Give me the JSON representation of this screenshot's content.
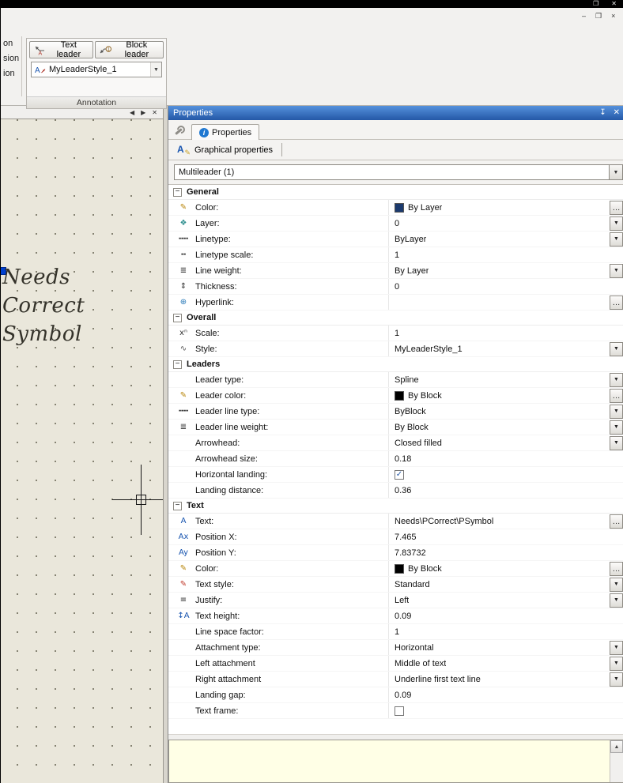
{
  "window": {
    "title_controls": [
      "❐",
      "✕"
    ],
    "doc_controls": [
      "–",
      "❐",
      "×"
    ]
  },
  "ribbon": {
    "left_fragments": [
      "on",
      "sion",
      "ion"
    ],
    "annotation_panel": {
      "text_leader_label": "Text leader",
      "block_leader_label": "Block leader",
      "style_value": "MyLeaderStyle_1",
      "panel_label": "Annotation"
    }
  },
  "canvas": {
    "tab_controls": {
      "prev": "◀",
      "next": "▶",
      "close": "✕"
    },
    "text_lines": [
      "Needs",
      "Correct",
      "Symbol"
    ]
  },
  "properties": {
    "header_title": "Properties",
    "pin_icon": "↧",
    "close_icon": "✕",
    "tab_label": "Properties",
    "tab_icon_letter": "i",
    "graphical_button": "Graphical properties",
    "graphical_icon_letter": "A",
    "graphical_icon_pen": "✎",
    "selector_value": "Multileader (1)",
    "description": "",
    "glyphs": {
      "dropdown": "▼",
      "ellipsis": "…",
      "check": "✓",
      "collapse": "−",
      "scroll_up": "▲"
    },
    "colors": {
      "header_blue": "#2458a6",
      "bylayer_swatch": "#1c3a6e",
      "byblock_swatch": "#000000"
    },
    "sections": [
      {
        "title": "General",
        "rows": [
          {
            "icon": "✎",
            "icon_color": "#b8860b",
            "icon_name": "pen-color-icon",
            "label": "Color:",
            "value": "By Layer",
            "swatch": "#1c3a6e",
            "control": "ellipsis"
          },
          {
            "icon": "❖",
            "icon_color": "#2f8f8f",
            "icon_name": "layers-icon",
            "label": "Layer:",
            "value": "0",
            "control": "dropdown"
          },
          {
            "icon": "╍╍",
            "icon_color": "#333333",
            "icon_name": "linetype-icon",
            "label": "Linetype:",
            "value": "ByLayer",
            "control": "dropdown"
          },
          {
            "icon": "╍",
            "icon_color": "#333333",
            "icon_name": "linetype-scale-icon",
            "label": "Linetype scale:",
            "value": "1",
            "control": "none"
          },
          {
            "icon": "≣",
            "icon_color": "#333333",
            "icon_name": "lineweight-icon",
            "label": "Line weight:",
            "value": "By Layer",
            "control": "dropdown"
          },
          {
            "icon": "⇕",
            "icon_color": "#333333",
            "icon_name": "thickness-icon",
            "label": "Thickness:",
            "value": "0",
            "control": "none"
          },
          {
            "icon": "⊕",
            "icon_color": "#2a7ab8",
            "icon_name": "hyperlink-globe-icon",
            "label": "Hyperlink:",
            "value": "",
            "control": "ellipsis"
          }
        ]
      },
      {
        "title": "Overall",
        "rows": [
          {
            "icon": "xⁿ",
            "icon_color": "#333333",
            "icon_name": "scale-icon",
            "label": "Scale:",
            "value": "1",
            "control": "none"
          },
          {
            "icon": "∿",
            "icon_color": "#555555",
            "icon_name": "leader-style-icon",
            "label": "Style:",
            "value": "MyLeaderStyle_1",
            "control": "dropdown"
          }
        ]
      },
      {
        "title": "Leaders",
        "rows": [
          {
            "icon": "",
            "label": "Leader type:",
            "value": "Spline",
            "control": "dropdown"
          },
          {
            "icon": "✎",
            "icon_color": "#b8860b",
            "icon_name": "pen-color-icon",
            "label": "Leader color:",
            "value": "By Block",
            "swatch": "#000000",
            "control": "ellipsis"
          },
          {
            "icon": "╍╍",
            "icon_color": "#333333",
            "icon_name": "linetype-icon",
            "label": "Leader line type:",
            "value": "ByBlock",
            "control": "dropdown"
          },
          {
            "icon": "≣",
            "icon_color": "#333333",
            "icon_name": "lineweight-icon",
            "label": "Leader line weight:",
            "value": "By Block",
            "control": "dropdown"
          },
          {
            "icon": "",
            "label": "Arrowhead:",
            "value": "Closed filled",
            "control": "dropdown"
          },
          {
            "icon": "",
            "label": "Arrowhead size:",
            "value": "0.18",
            "control": "none"
          },
          {
            "icon": "",
            "label": "Horizontal landing:",
            "value": "",
            "checkbox": true,
            "checked": true,
            "control": "none"
          },
          {
            "icon": "",
            "label": "Landing distance:",
            "value": "0.36",
            "control": "none"
          }
        ]
      },
      {
        "title": "Text",
        "rows": [
          {
            "icon": "A",
            "icon_color": "#1a56b0",
            "icon_name": "text-contents-icon",
            "label": "Text:",
            "value": "Needs\\PCorrect\\PSymbol",
            "control": "ellipsis"
          },
          {
            "icon": "Ax",
            "icon_color": "#1a56b0",
            "icon_name": "position-x-icon",
            "label": "Position X:",
            "value": "7.465",
            "control": "none"
          },
          {
            "icon": "Ay",
            "icon_color": "#1a56b0",
            "icon_name": "position-y-icon",
            "label": "Position Y:",
            "value": "7.83732",
            "control": "none"
          },
          {
            "icon": "✎",
            "icon_color": "#b8860b",
            "icon_name": "pen-color-icon",
            "label": "Color:",
            "value": "By Block",
            "swatch": "#000000",
            "control": "ellipsis"
          },
          {
            "icon": "✎",
            "icon_color": "#c0392b",
            "icon_name": "text-style-icon",
            "label": "Text style:",
            "value": "Standard",
            "control": "dropdown"
          },
          {
            "icon": "≡",
            "icon_color": "#333333",
            "icon_name": "justify-icon",
            "label": "Justify:",
            "value": "Left",
            "control": "dropdown"
          },
          {
            "icon": "↕A",
            "icon_color": "#1a56b0",
            "icon_name": "text-height-icon",
            "label": "Text height:",
            "value": "0.09",
            "control": "none"
          },
          {
            "icon": "",
            "label": "Line space factor:",
            "value": "1",
            "control": "none"
          },
          {
            "icon": "",
            "label": "Attachment type:",
            "value": "Horizontal",
            "control": "dropdown"
          },
          {
            "icon": "",
            "label": "Left attachment",
            "value": "Middle of text",
            "control": "dropdown"
          },
          {
            "icon": "",
            "label": "Right attachment",
            "value": "Underline first text line",
            "control": "dropdown"
          },
          {
            "icon": "",
            "label": "Landing gap:",
            "value": "0.09",
            "control": "none"
          },
          {
            "icon": "",
            "label": "Text frame:",
            "value": "",
            "checkbox": true,
            "checked": false,
            "control": "none"
          }
        ]
      }
    ]
  }
}
